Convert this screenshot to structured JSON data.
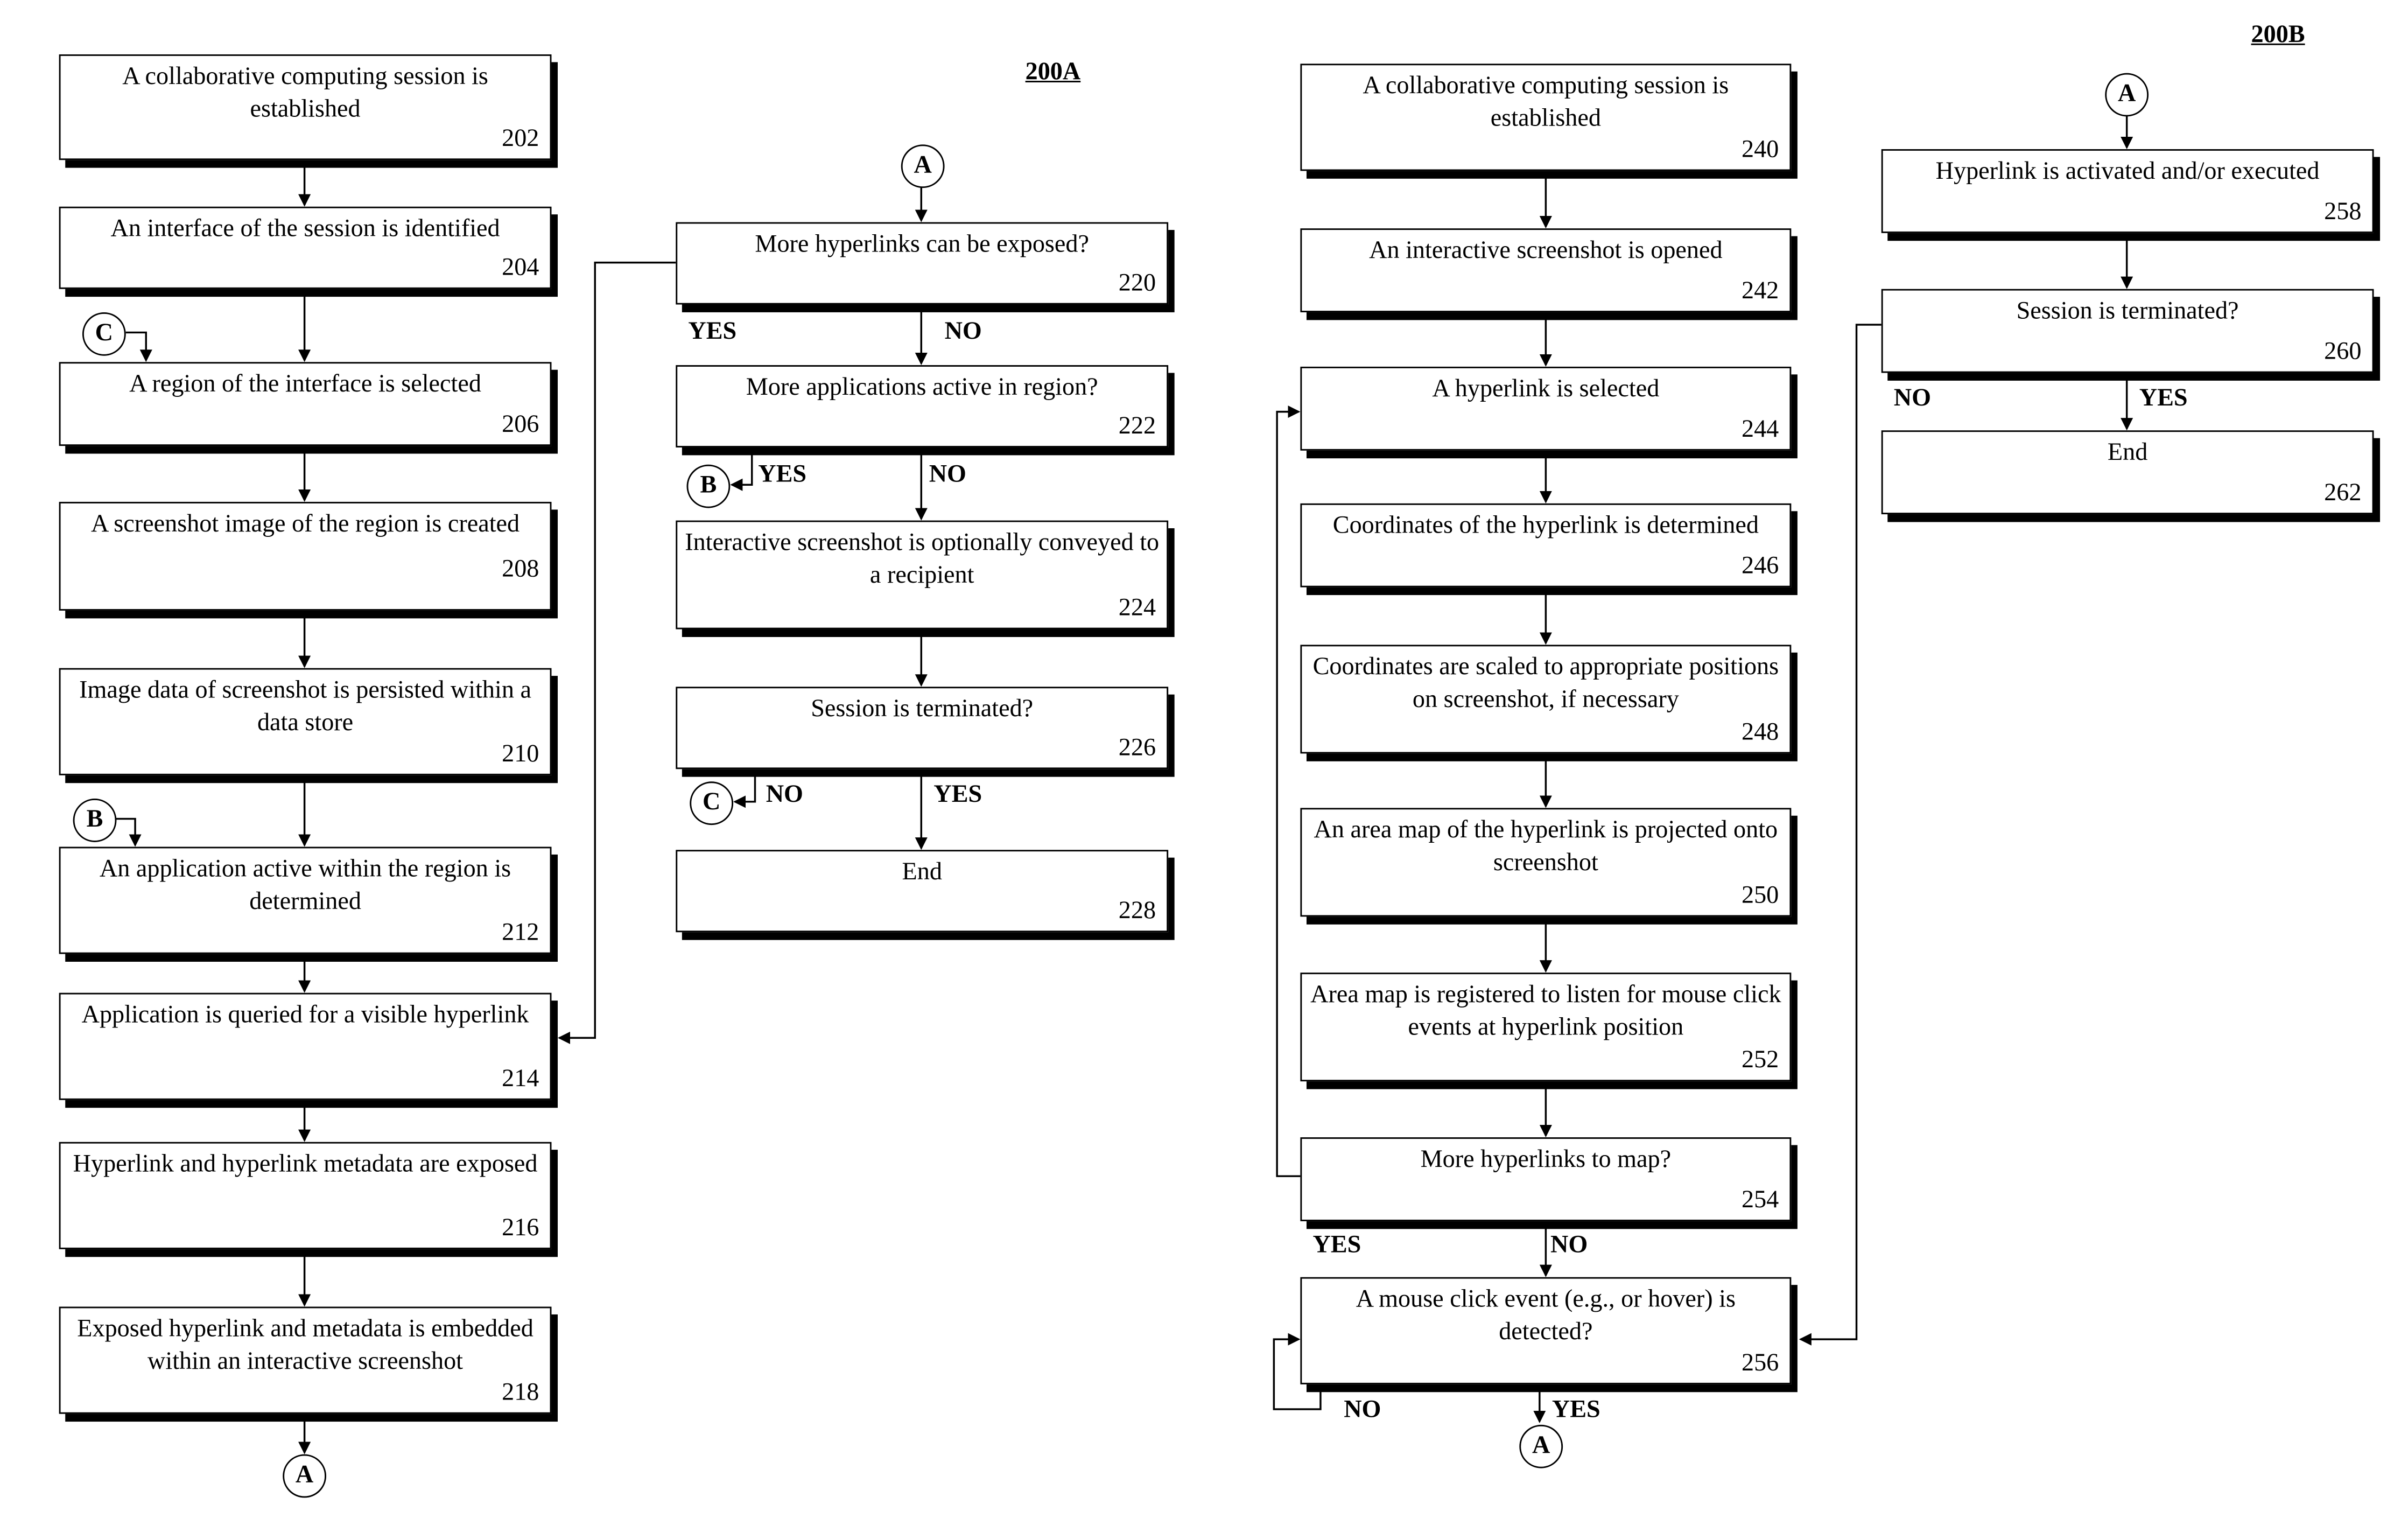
{
  "figures": {
    "fig_a_label": "200A",
    "fig_b_label": "200B"
  },
  "steps": {
    "s202": {
      "text": "A collaborative computing session is established",
      "ref": "202"
    },
    "s204": {
      "text": "An interface of the session is identified",
      "ref": "204"
    },
    "s206": {
      "text": "A region of the interface is selected",
      "ref": "206"
    },
    "s208": {
      "text": "A screenshot image of the region is created",
      "ref": "208"
    },
    "s210": {
      "text": "Image data of screenshot is persisted within a data store",
      "ref": "210"
    },
    "s212": {
      "text": "An application active within the region is determined",
      "ref": "212"
    },
    "s214": {
      "text": "Application is queried for a visible hyperlink",
      "ref": "214"
    },
    "s216": {
      "text": "Hyperlink and hyperlink metadata are exposed",
      "ref": "216"
    },
    "s218": {
      "text": "Exposed hyperlink and metadata is embedded within an interactive screenshot",
      "ref": "218"
    },
    "s220": {
      "text": "More hyperlinks can be exposed?",
      "ref": "220"
    },
    "s222": {
      "text": "More applications active in region?",
      "ref": "222"
    },
    "s224": {
      "text": "Interactive screenshot is optionally conveyed to a recipient",
      "ref": "224"
    },
    "s226": {
      "text": "Session is terminated?",
      "ref": "226"
    },
    "s228": {
      "text": "End",
      "ref": "228"
    },
    "s240": {
      "text": "A collaborative computing session is established",
      "ref": "240"
    },
    "s242": {
      "text": "An interactive screenshot is opened",
      "ref": "242"
    },
    "s244": {
      "text": "A hyperlink is selected",
      "ref": "244"
    },
    "s246": {
      "text": "Coordinates of the hyperlink is determined",
      "ref": "246"
    },
    "s248": {
      "text": "Coordinates are scaled to appropriate positions on screenshot, if necessary",
      "ref": "248"
    },
    "s250": {
      "text": "An area map of the hyperlink is projected onto screenshot",
      "ref": "250"
    },
    "s252": {
      "text": "Area map is registered to listen for mouse click events at hyperlink position",
      "ref": "252"
    },
    "s254": {
      "text": "More hyperlinks to map?",
      "ref": "254"
    },
    "s256": {
      "text": "A mouse click event (e.g., or hover) is detected?",
      "ref": "256"
    },
    "s258": {
      "text": "Hyperlink is activated and/or executed",
      "ref": "258"
    },
    "s260": {
      "text": "Session is terminated?",
      "ref": "260"
    },
    "s262": {
      "text": "End",
      "ref": "262"
    }
  },
  "branches": {
    "yes": "YES",
    "no": "NO"
  },
  "connectors": {
    "a": "A",
    "b": "B",
    "c": "C"
  }
}
